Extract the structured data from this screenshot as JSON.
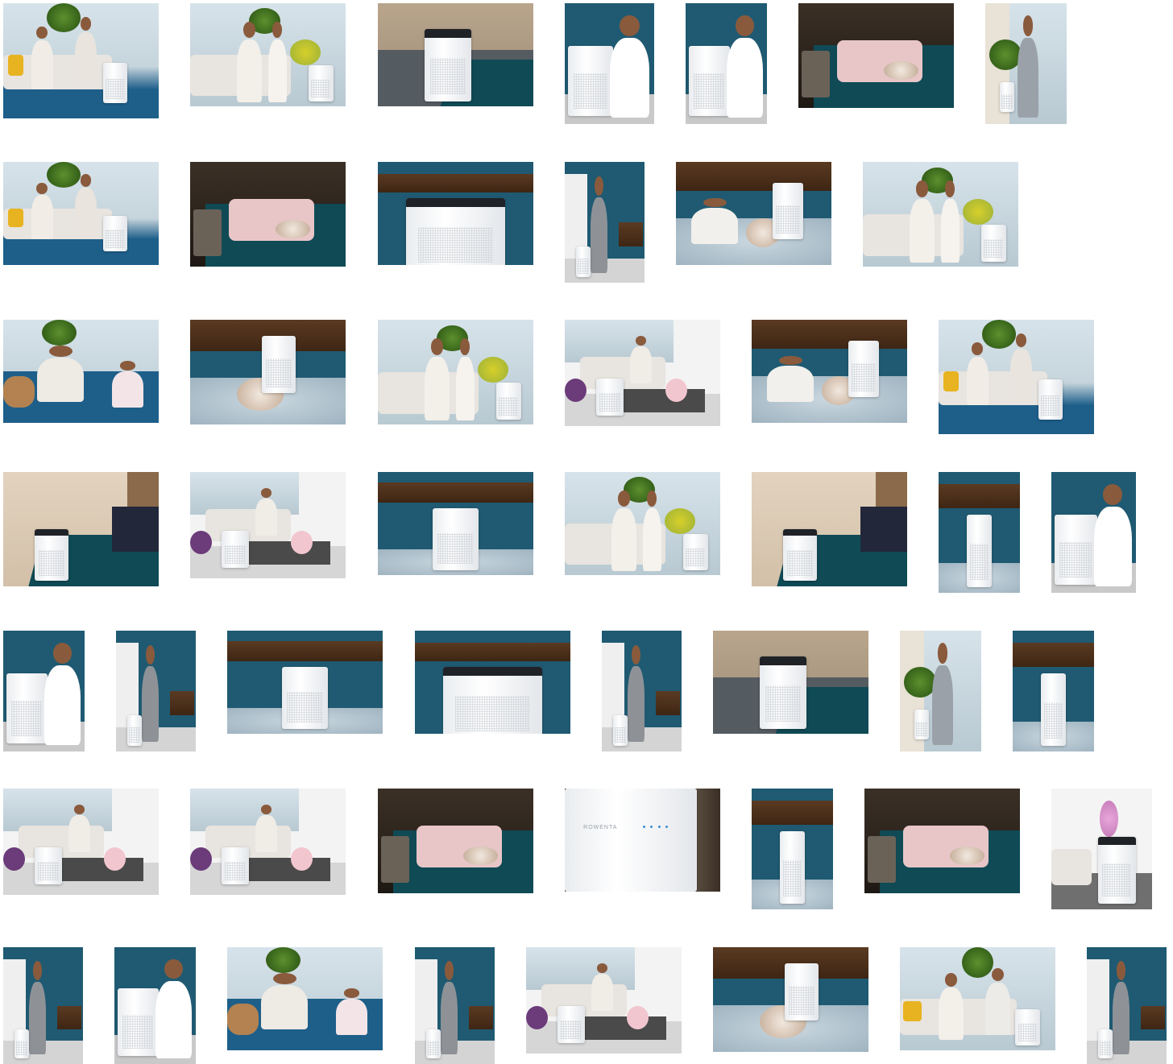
{
  "gallery": {
    "title": "",
    "product_logo_text": "ROWENTA",
    "thumbnails": [
      {
        "scene": "living-room-family"
      },
      {
        "scene": "sofa-mother-daughter-flowers"
      },
      {
        "scene": "purifier-bedroom-closeup"
      },
      {
        "scene": "woman-opening-purifier"
      },
      {
        "scene": "woman-filter-purifier"
      },
      {
        "scene": "bedroom-cat-sleeping"
      },
      {
        "scene": "man-window-standing"
      },
      {
        "scene": "living-room-family-2"
      },
      {
        "scene": "bedroom-cat-sleeping-2"
      },
      {
        "scene": "purifier-top-closeup-teal"
      },
      {
        "scene": "man-door-teal"
      },
      {
        "scene": "girl-cat-rug"
      },
      {
        "scene": "mother-daughter-sofa"
      },
      {
        "scene": "father-child-rug-blocks"
      },
      {
        "scene": "cat-rug-purifier"
      },
      {
        "scene": "mother-daughter-sofa-2"
      },
      {
        "scene": "bright-living-baby"
      },
      {
        "scene": "girl-cat-rug-2"
      },
      {
        "scene": "living-room-family-3"
      },
      {
        "scene": "bedroom-lamp-purifier"
      },
      {
        "scene": "bright-living-baby-2"
      },
      {
        "scene": "purifier-rug-teal"
      },
      {
        "scene": "mother-daughter-flowers-2"
      },
      {
        "scene": "bedroom-lamp-purifier-2"
      },
      {
        "scene": "teal-shelves-purifier"
      },
      {
        "scene": "woman-hands-purifier"
      },
      {
        "scene": "woman-filter-side"
      },
      {
        "scene": "man-door-teal-2"
      },
      {
        "scene": "purifier-rug-teal-2"
      },
      {
        "scene": "purifier-top-closeup-teal-2"
      },
      {
        "scene": "man-door-teal-3"
      },
      {
        "scene": "purifier-bedroom-closeup-2"
      },
      {
        "scene": "man-window-standing-2"
      },
      {
        "scene": "purifier-teal-shelves-2"
      },
      {
        "scene": "bright-living-baby-3"
      },
      {
        "scene": "bright-living-baby-4"
      },
      {
        "scene": "bedroom-cat-sleeping-3"
      },
      {
        "scene": "purifier-panel-closeup"
      },
      {
        "scene": "teal-shelves-purifier-2"
      },
      {
        "scene": "bedroom-cat-sleeping-4"
      },
      {
        "scene": "white-room-orchid"
      },
      {
        "scene": "man-door-teal-4"
      },
      {
        "scene": "woman-filter-dark"
      },
      {
        "scene": "father-child-rug-blocks-2"
      },
      {
        "scene": "man-door-teal-5"
      },
      {
        "scene": "bright-living-baby-5"
      },
      {
        "scene": "cat-rug-purifier-2"
      },
      {
        "scene": "couple-sofa-yellow"
      },
      {
        "scene": "man-door-teal-6"
      }
    ]
  }
}
